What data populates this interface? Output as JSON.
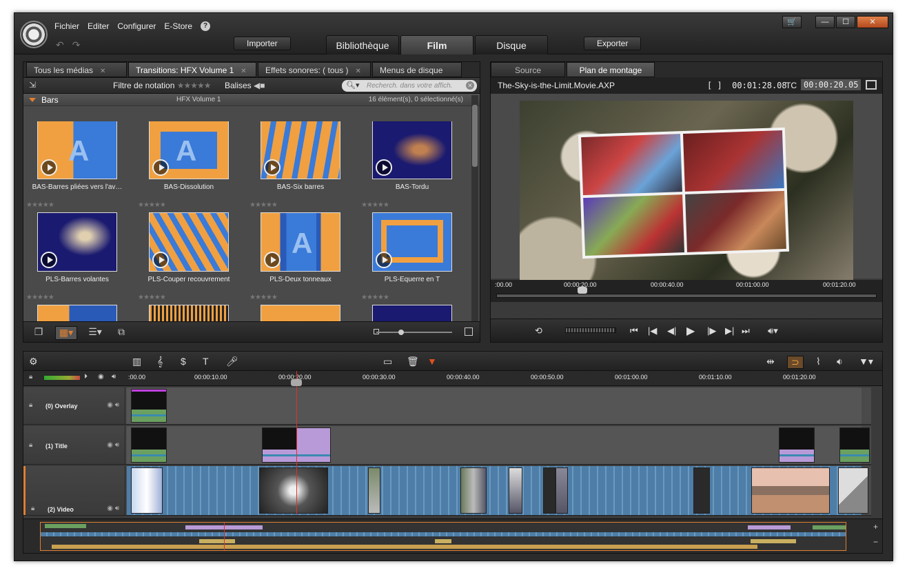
{
  "menu": {
    "file": "Fichier",
    "edit": "Editer",
    "configure": "Configurer",
    "estore": "E-Store",
    "help": "?"
  },
  "toolbar": {
    "import": "Importer",
    "export": "Exporter"
  },
  "main_tabs": {
    "library": "Bibliothèque",
    "film": "Film",
    "disc": "Disque"
  },
  "window_buttons": {
    "cart": "🛒",
    "minimize": "—",
    "maximize": "☐",
    "close": "✕"
  },
  "library": {
    "tabs": {
      "all_media": "Tous les médias",
      "transitions": "Transitions: HFX Volume 1",
      "sound_fx": "Effets sonores: ( tous )",
      "disc_menus": "Menus de disque"
    },
    "filter_label": "Filtre de notation",
    "tags_label": "Balises",
    "search_placeholder": "Recherch. dans votre affich.",
    "group": {
      "name": "Bars",
      "subtitle": "HFX Volume 1",
      "count": "16 élément(s), 0 sélectionné(s)"
    },
    "items": [
      "BAS-Barres pliées vers l'av…",
      "BAS-Dissolution",
      "BAS-Six barres",
      "BAS-Tordu",
      "PLS-Barres volantes",
      "PLS-Couper recouvrement",
      "PLS-Deux tonneaux",
      "PLS-Equerre en T"
    ],
    "stars": "★★★★★"
  },
  "player": {
    "tabs": {
      "source": "Source",
      "montage": "Plan de montage"
    },
    "filename": "The-Sky-is-the-Limit.Movie.AXP",
    "duration_icon": "[ ]",
    "duration": "00:01:28.08",
    "tc_label": "TC",
    "timecode": "00:00:20.05",
    "ruler": [
      ":00.00",
      "00:00:20.00",
      "00:00:40.00",
      "00:01:00.00",
      "00:01:20.00"
    ]
  },
  "timeline": {
    "ruler": [
      ":00.00",
      "00:00:10.00",
      "00:00:20.00",
      "00:00:30.00",
      "00:00:40.00",
      "00:00:50.00",
      "00:01:00.00",
      "00:01:10.00",
      "00:01:20.00"
    ],
    "tracks": [
      "(0) Overlay",
      "(1) Title",
      "(2) Video"
    ]
  },
  "colors": {
    "accent": "#e08030",
    "playhead": "#e03030",
    "title_clip": "#b89ad8",
    "audio_clip": "#6aa060"
  }
}
